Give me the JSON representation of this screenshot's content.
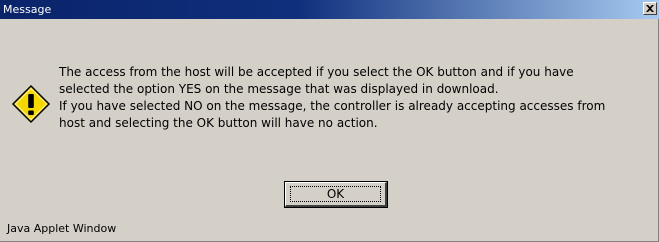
{
  "window": {
    "title": "Message",
    "close_icon": "close-icon",
    "title_gradient_start": "#0a246a",
    "title_gradient_end": "#a6caf0",
    "background": "#d4d0c8"
  },
  "message": {
    "icon": "warning-icon",
    "icon_color": "#f5d800",
    "lines": [
      "The access from the host will be accepted if you select the OK button and if you have",
      "selected the option YES on the message that was displayed in download.",
      "If you have selected NO on the message, the controller is already accepting accesses from",
      "host and selecting the OK button will have no action."
    ]
  },
  "buttons": {
    "ok_label": "OK"
  },
  "footer": {
    "label": "Java Applet Window"
  }
}
